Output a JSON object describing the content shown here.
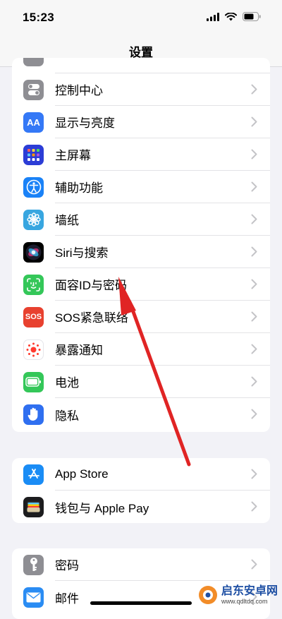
{
  "status_bar": {
    "time": "15:23"
  },
  "nav": {
    "title": "设置"
  },
  "group1": {
    "items": [
      {
        "label": "控制中心"
      },
      {
        "label": "显示与亮度",
        "icon_text": "AA"
      },
      {
        "label": "主屏幕"
      },
      {
        "label": "辅助功能"
      },
      {
        "label": "墙纸"
      },
      {
        "label": "Siri与搜索"
      },
      {
        "label": "面容ID与密码"
      },
      {
        "label": "SOS紧急联络",
        "icon_text": "SOS"
      },
      {
        "label": "暴露通知"
      },
      {
        "label": "电池"
      },
      {
        "label": "隐私"
      }
    ]
  },
  "group2": {
    "items": [
      {
        "label": "App Store"
      },
      {
        "label": "钱包与 Apple Pay"
      }
    ]
  },
  "group3": {
    "items": [
      {
        "label": "密码"
      },
      {
        "label": "邮件"
      }
    ]
  },
  "watermark": {
    "main": "启东安卓网",
    "sub": "www.qdltdq.com"
  },
  "colors": {
    "background": "#f2f2f7",
    "chevron": "#c4c4c7",
    "arrow": "#e02424",
    "control_center": "#8e8e93",
    "display": "#3478f6",
    "home_screen": "#2c3dd6",
    "accessibility": "#1a82f7",
    "wallpaper": "#38a6e0",
    "face_id": "#34c759",
    "sos": "#e8412f",
    "battery": "#34c759",
    "privacy": "#2f6ff0",
    "app_store": "#1a8cf5",
    "passwords": "#8e8e93",
    "mail": "#2a8cf3"
  }
}
